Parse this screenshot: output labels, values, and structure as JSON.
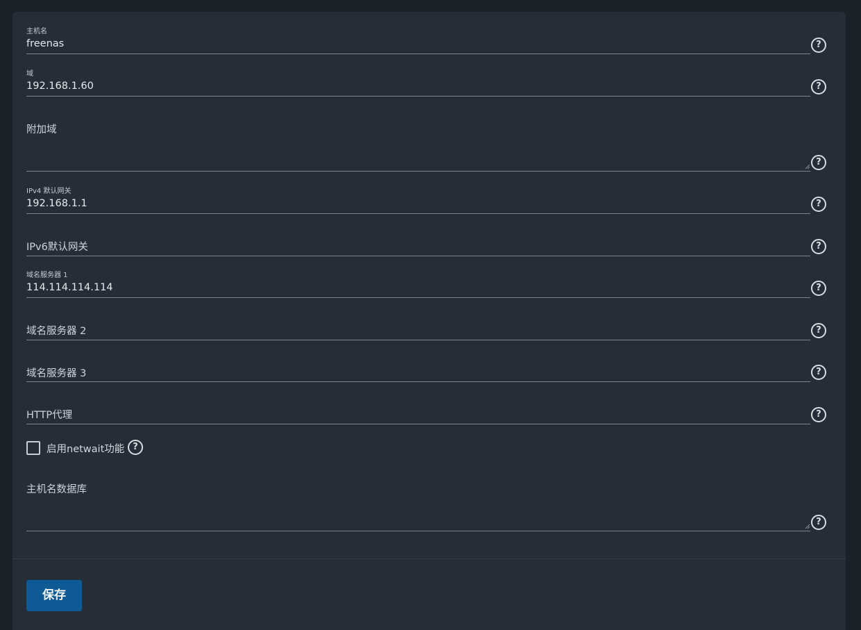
{
  "fields": {
    "hostname": {
      "label": "主机名",
      "value": "freenas"
    },
    "domain": {
      "label": "域",
      "value": "192.168.1.60"
    },
    "additional_domains": {
      "label": "附加域",
      "value": ""
    },
    "ipv4_gateway": {
      "label": "IPv4 默认网关",
      "value": "192.168.1.1"
    },
    "ipv6_gateway": {
      "label": "IPv6默认网关",
      "value": ""
    },
    "nameserver1": {
      "label": "域名服务器 1",
      "value": "114.114.114.114"
    },
    "nameserver2": {
      "label": "域名服务器 2",
      "value": ""
    },
    "nameserver3": {
      "label": "域名服务器 3",
      "value": ""
    },
    "http_proxy": {
      "label": "HTTP代理",
      "value": ""
    },
    "hostname_database": {
      "label": "主机名数据库",
      "value": ""
    }
  },
  "netwait": {
    "label": "启用netwait功能",
    "checked": false
  },
  "help_glyph": "?",
  "save_label": "保存",
  "icons": {
    "help": "help-circle-icon",
    "checkbox": "checkbox-unchecked-icon"
  }
}
